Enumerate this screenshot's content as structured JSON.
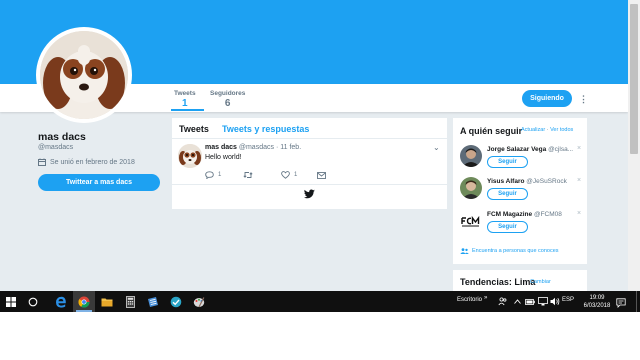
{
  "colors": {
    "accent": "#1da1f2",
    "page_bg": "#e6ecf0",
    "muted": "#657786",
    "taskbar": "#101010"
  },
  "profile": {
    "name": "mas dacs",
    "handle": "@masdacs",
    "joined": "Se unió en febrero de 2018",
    "tweet_to_label": "Twittear a mas dacs",
    "stats": [
      {
        "label": "Tweets",
        "value": "1"
      },
      {
        "label": "Seguidores",
        "value": "6"
      }
    ],
    "following_label": "Siguiendo"
  },
  "timeline": {
    "tabs": [
      "Tweets",
      "Tweets y respuestas"
    ],
    "tweet": {
      "name": "mas dacs",
      "handle": "@masdacs",
      "separator": "·",
      "date": "11 feb.",
      "text": "Hello world!",
      "reply_count": "1",
      "retweet_count": "",
      "like_count": "1"
    }
  },
  "who_to_follow": {
    "title": "A quién seguir",
    "refresh_label": "Actualizar",
    "separator": "·",
    "view_all_label": "Ver todos",
    "suggestions": [
      {
        "name": "Jorge Salazar Vega",
        "handle": "@cjlsa...",
        "button": "Seguir",
        "close": "×"
      },
      {
        "name": "Yisus Alfaro",
        "handle": "@JeSuSRock",
        "button": "Seguir",
        "close": "×"
      },
      {
        "name": "FCM Magazine",
        "handle": "@FCM08",
        "button": "Seguir",
        "close": "×"
      }
    ],
    "find_people_label": "Encuentra a personas que conoces"
  },
  "trends": {
    "title": "Tendencias: Lima",
    "change_label": "Cambiar"
  },
  "taskbar": {
    "desktop_label": "Escritorio",
    "desktop_chevron": "»",
    "language": "ESP",
    "time": "19:09",
    "date": "6/03/2018",
    "icons": [
      "windows-start-icon",
      "cortana-icon",
      "edge-icon",
      "chrome-icon",
      "file-explorer-icon",
      "calculator-icon",
      "app-icon",
      "vpn-icon",
      "paint-icon"
    ]
  }
}
